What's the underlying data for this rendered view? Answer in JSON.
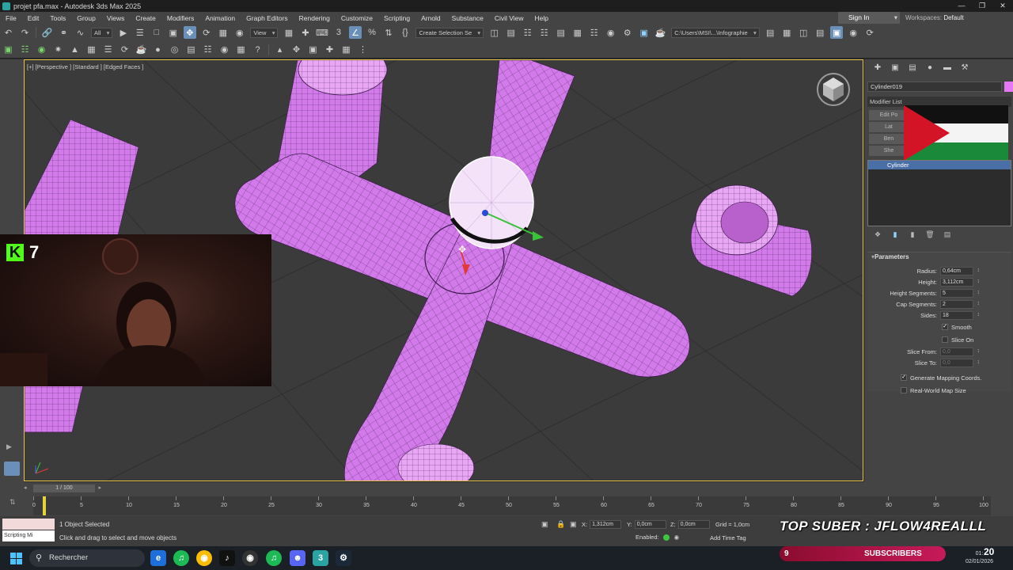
{
  "window": {
    "title": "projet pfa.max - Autodesk 3ds Max 2025",
    "controls": [
      "—",
      "❐",
      "✕"
    ]
  },
  "menu": [
    "File",
    "Edit",
    "Tools",
    "Group",
    "Views",
    "Create",
    "Modifiers",
    "Animation",
    "Graph Editors",
    "Rendering",
    "Customize",
    "Scripting",
    "Arnold",
    "Substance",
    "Civil View",
    "Help"
  ],
  "account": {
    "signin": "Sign In",
    "workspaces_label": "Workspaces:",
    "workspace": "Default"
  },
  "toolbar": {
    "filter": "All",
    "refcoord": "View",
    "selection_set": "Create Selection Se",
    "project_path": "C:\\Users\\MSI\\...\\Infographie"
  },
  "viewport": {
    "label": "[+] [Perspective ] [Standard ] [Edged Faces ]",
    "object_color": "#d27aea",
    "wire_color": "#3a1a4a",
    "selection_color": "#ffffff"
  },
  "webcam": {
    "platform": "K",
    "viewer_count": "7"
  },
  "command_panel": {
    "object_name": "Cylinder019",
    "object_color": "#e678f5",
    "modifier_list": "Modifier List",
    "modifier_buttons": [
      "Edit Po",
      "Lat",
      "Ben",
      "She"
    ],
    "stack": [
      "Cylinder"
    ],
    "parameters": {
      "title": "Parameters",
      "fields": [
        {
          "label": "Radius:",
          "value": "0,64cm",
          "dim": false
        },
        {
          "label": "Height:",
          "value": "3,112cm",
          "dim": false
        },
        {
          "label": "Height Segments:",
          "value": "5",
          "dim": false
        },
        {
          "label": "Cap Segments:",
          "value": "2",
          "dim": false
        },
        {
          "label": "Sides:",
          "value": "18",
          "dim": false
        }
      ],
      "smooth": "Smooth",
      "slice_on": "Slice On",
      "slice_fields": [
        {
          "label": "Slice From:",
          "value": "0,0",
          "dim": true
        },
        {
          "label": "Slice To:",
          "value": "0,0",
          "dim": true
        }
      ],
      "gen_mapping": "Generate Mapping Coords.",
      "real_world": "Real-World Map Size"
    }
  },
  "timeline": {
    "frame": "1 / 100",
    "ticks": [
      "0",
      "5",
      "10",
      "15",
      "20",
      "25",
      "30",
      "35",
      "40",
      "45",
      "50",
      "55",
      "60",
      "65",
      "70",
      "75",
      "80",
      "85",
      "90",
      "95",
      "100"
    ]
  },
  "status": {
    "script_input": "Scripting Mi",
    "selection": "1 Object Selected",
    "hint": "Click and drag to select and move objects",
    "x_label": "X:",
    "x": "1,312cm",
    "y_label": "Y:",
    "y": "0,0cm",
    "z_label": "Z:",
    "z": "0,0cm",
    "grid": "Grid = 1,0cm",
    "enabled": "Enabled:",
    "add_time_tag": "Add Time Tag"
  },
  "overlay": {
    "top_suber": "TOP SUBER : JFLOW4REALLL",
    "sub_count": "9",
    "subscribers": "SUBSCRIBERS"
  },
  "taskbar": {
    "search": "Rechercher",
    "time": "01:",
    "date": "02/01/2026",
    "time_big": "20"
  }
}
